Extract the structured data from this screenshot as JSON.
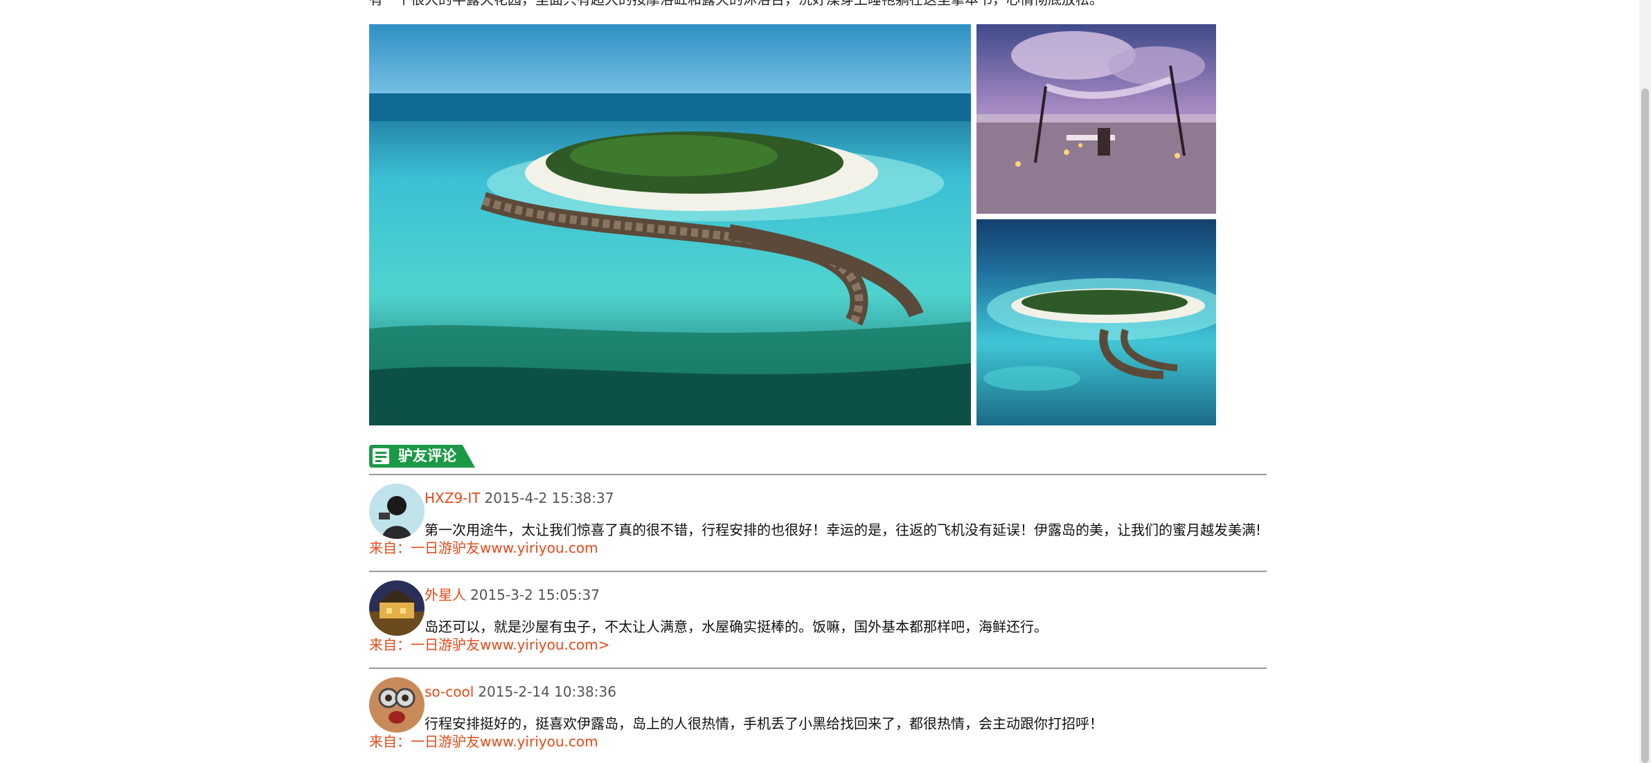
{
  "intro": {
    "text": "有一个很大的半露天花园，里面只有超大的按摩浴缸和露天的沐浴台，洗好澡穿上睡袍躺在这里拿本书，心情彻底放松。"
  },
  "gallery": {
    "main_alt": "aerial-view-island-overwater-villas",
    "side1_alt": "beach-dinner-canopy-sunset",
    "side2_alt": "aerial-view-island-lagoon"
  },
  "reviews": {
    "title": "驴友评论",
    "icon": "comment-list-icon",
    "accent": "#1b9a46",
    "items": [
      {
        "user": "HXZ9-IT",
        "time": "2015-4-2 15:38:37",
        "text": "第一次用途牛，太让我们惊喜了真的很不错，行程安排的也很好！幸运的是，往返的飞机没有延误！伊露岛的美，让我们的蜜月越发美满!",
        "source": "来自：一日游驴友www.yiriyou.com"
      },
      {
        "user": "外星人",
        "time": "2015-3-2 15:05:37",
        "text": "岛还可以，就是沙屋有虫子，不太让人满意，水屋确实挺棒的。饭嘛，国外基本都那样吧，海鲜还行。",
        "source": "来自：一日游驴友www.yiriyou.com>"
      },
      {
        "user": "so-cool",
        "time": "2015-2-14 10:38:36",
        "text": "行程安排挺好的，挺喜欢伊露岛，岛上的人很热情，手机丢了小黑给找回来了，都很热情，会主动跟你打招呼！",
        "source": "来自：一日游驴友www.yiriyou.com"
      }
    ]
  },
  "colors": {
    "username": "#e64a19",
    "source": "#e64a19",
    "divider": "#9a9a9a"
  }
}
